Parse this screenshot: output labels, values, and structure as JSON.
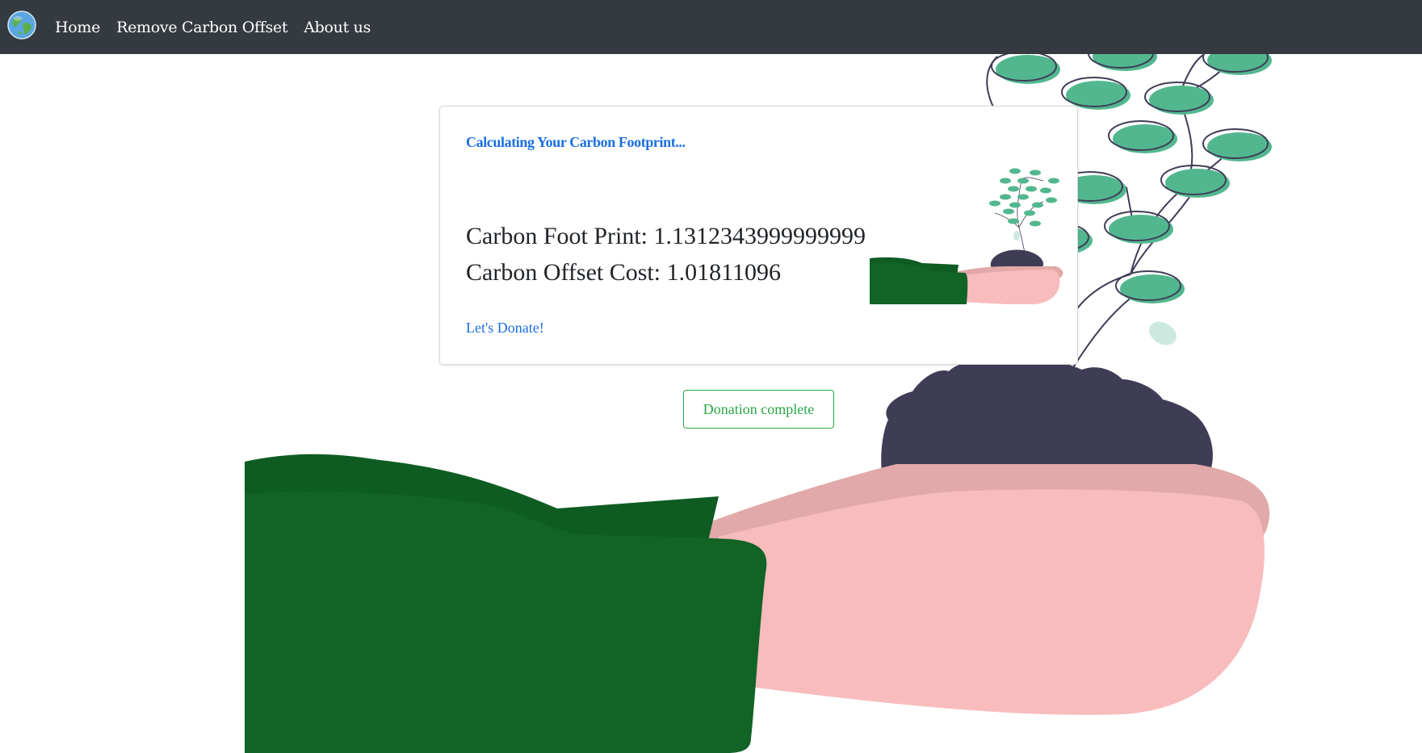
{
  "nav": {
    "logo_icon": "earth-globe-icon",
    "links": [
      {
        "label": "Home"
      },
      {
        "label": "Remove Carbon Offset"
      },
      {
        "label": "About us"
      }
    ]
  },
  "card": {
    "title": "Calculating Your Carbon Footprint...",
    "footprint_text": "Carbon Foot Print: 1.1312343999999999",
    "offset_text": "Carbon Offset Cost: 1.01811096",
    "donate_link": "Let's Donate!",
    "illustration": "hand-holding-plant-illustration"
  },
  "donation_button": {
    "label": "Donation complete"
  },
  "background_illustration": "hand-holding-seedling-illustration",
  "colors": {
    "navbar": "#343a40",
    "link_blue": "#1a6fe0",
    "success_green": "#28a745",
    "sleeve_green": "#116326",
    "leaf_green": "#52b78f",
    "skin_pink": "#f8bcbc",
    "soil_dark": "#3f3d56"
  }
}
